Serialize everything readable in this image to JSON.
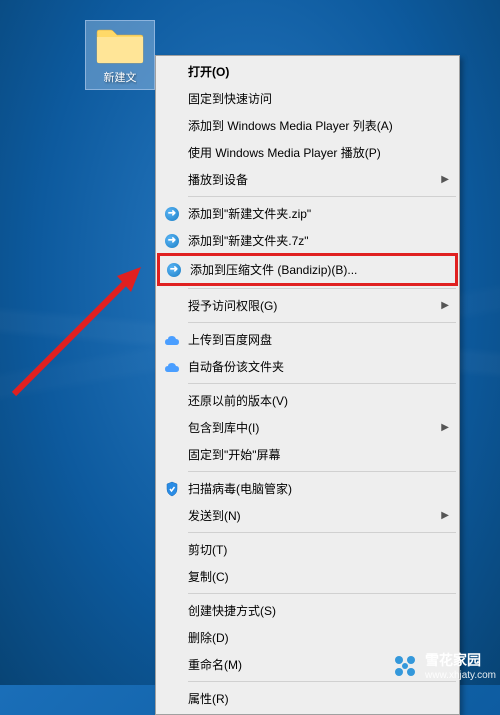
{
  "desktop": {
    "folder_label": "新建文"
  },
  "context_menu": {
    "open": "打开(O)",
    "pin_quick_access": "固定到快速访问",
    "add_to_wmp_list": "添加到 Windows Media Player 列表(A)",
    "play_with_wmp": "使用 Windows Media Player 播放(P)",
    "play_to_device": "播放到设备",
    "add_zip": "添加到\"新建文件夹.zip\"",
    "add_7z": "添加到\"新建文件夹.7z\"",
    "add_compress_bandizip": "添加到压缩文件 (Bandizip)(B)...",
    "grant_access": "授予访问权限(G)",
    "upload_baidu": "上传到百度网盘",
    "auto_backup": "自动备份该文件夹",
    "restore_previous": "还原以前的版本(V)",
    "include_library": "包含到库中(I)",
    "pin_start": "固定到\"开始\"屏幕",
    "scan_virus": "扫描病毒(电脑管家)",
    "send_to": "发送到(N)",
    "cut": "剪切(T)",
    "copy": "复制(C)",
    "create_shortcut": "创建快捷方式(S)",
    "delete": "删除(D)",
    "rename": "重命名(M)",
    "properties": "属性(R)"
  },
  "watermark": {
    "brand": "雪花家园",
    "url": "www.xhjaty.com"
  }
}
